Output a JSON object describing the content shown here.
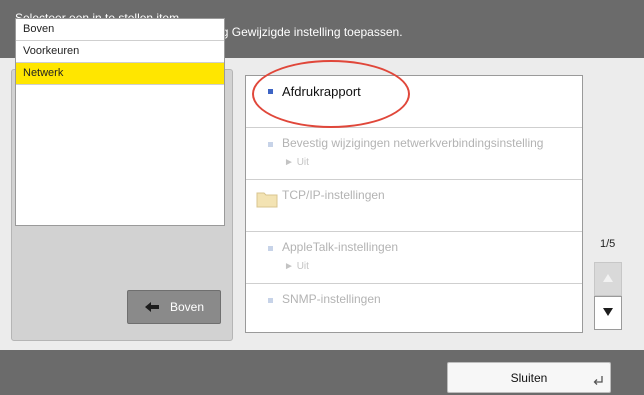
{
  "header": {
    "line1": "Selecteer een in te stellen item.",
    "line2": "Wijzigingen zijn van kracht na uitvoering Gewijzigde instelling toepassen."
  },
  "nav": {
    "items": [
      {
        "label": "Boven"
      },
      {
        "label": "Voorkeuren"
      },
      {
        "label": "Netwerk",
        "selected": true
      }
    ],
    "up_button_label": "Boven"
  },
  "settings": {
    "items": [
      {
        "label": "Afdrukrapport",
        "enabled": true
      },
      {
        "label": "Bevestig wijzigingen netwerkverbindingsinstelling",
        "value": "Uit",
        "enabled": false
      },
      {
        "label": "TCP/IP-instellingen",
        "enabled": false,
        "icon": "folder-icon"
      },
      {
        "label": "AppleTalk-instellingen",
        "value": "Uit",
        "enabled": false
      },
      {
        "label": "SNMP-instellingen",
        "enabled": false
      }
    ]
  },
  "pagination": {
    "indicator": "1/5"
  },
  "footer": {
    "close_label": "Sluiten"
  },
  "colors": {
    "selected_highlight": "#ffe600",
    "header_bar": "#6b6b6b",
    "annotation": "#e0473a"
  }
}
